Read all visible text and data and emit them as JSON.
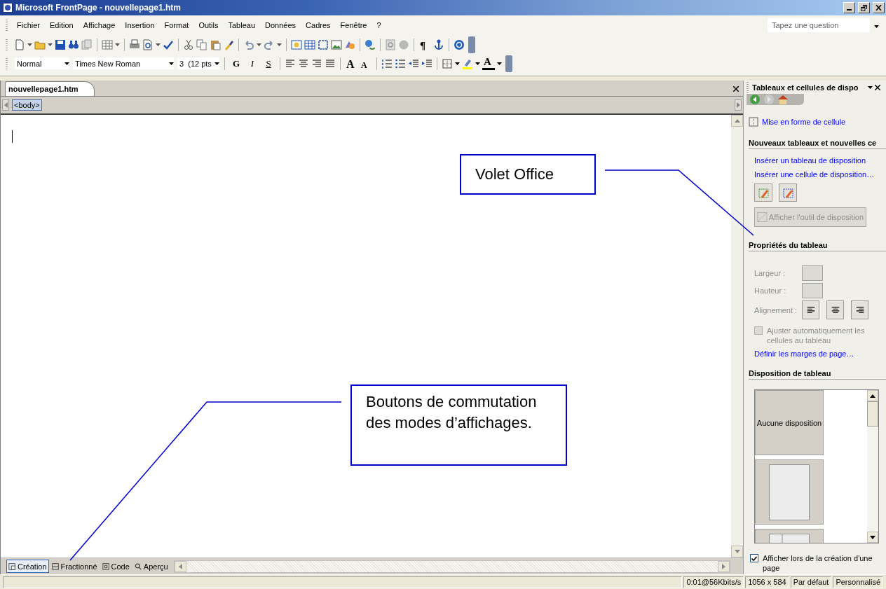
{
  "window": {
    "title": "Microsoft FrontPage - nouvellepage1.htm"
  },
  "menu": [
    {
      "label": "Fichier"
    },
    {
      "label": "Edition"
    },
    {
      "label": "Affichage"
    },
    {
      "label": "Insertion"
    },
    {
      "label": "Format"
    },
    {
      "label": "Outils"
    },
    {
      "label": "Tableau"
    },
    {
      "label": "Données"
    },
    {
      "label": "Cadres"
    },
    {
      "label": "Fenêtre"
    },
    {
      "label": "?"
    }
  ],
  "help_field": {
    "placeholder": "Tapez une question"
  },
  "standard_toolbar": {
    "paragraph_mark": "¶"
  },
  "formatting_toolbar": {
    "style": "Normal",
    "font": "Times New Roman",
    "size": "3  (12 pts",
    "styles": [
      {
        "kind": "bold",
        "label": "G"
      },
      {
        "kind": "italic",
        "label": "I"
      },
      {
        "kind": "strike",
        "label": "S"
      }
    ],
    "grow_font": "A",
    "shrink_font": "A",
    "font_color": "A"
  },
  "document": {
    "tabs": [
      {
        "label": "nouvellepage1.htm",
        "selected": true
      }
    ],
    "quick_tag": "<body>"
  },
  "view_tabs": [
    {
      "kind": "design",
      "label": "Création",
      "selected": true
    },
    {
      "kind": "split",
      "label": "Fractionné",
      "selected": false
    },
    {
      "kind": "code",
      "label": "Code",
      "selected": false
    },
    {
      "kind": "preview",
      "label": "Aperçu",
      "selected": false
    }
  ],
  "task_pane": {
    "title": "Tableaux et cellules de dispo",
    "cell_format_link": "Mise en forme de cellule",
    "new_tables": {
      "heading": "Nouveaux tableaux et nouvelles ce",
      "links": [
        "Insérer un tableau de disposition",
        "Insérer une cellule de disposition…"
      ],
      "tool_button": {
        "label": "Afficher l'outil de disposition",
        "disabled": true
      }
    },
    "table_properties": {
      "heading": "Propriétés du tableau",
      "disabled": true,
      "width_label": "Largeur :",
      "height_label": "Hauteur :",
      "align_label": "Alignement :",
      "autofit": {
        "label": "Ajuster automatiquement les cellules au tableau",
        "checked": false
      },
      "margins_link": "Définir les marges de page…"
    },
    "table_layout": {
      "heading": "Disposition de tableau",
      "layouts": [
        {
          "kind": "none",
          "label": "Aucune disposition",
          "selected": false
        },
        {
          "kind": "centered",
          "selected": false
        },
        {
          "kind": "columns",
          "selected": false
        }
      ]
    },
    "show_on_create": {
      "label": "Afficher lors de la création d'une page",
      "checked": true
    }
  },
  "status_bar": [
    "0:01@56Kbits/s",
    "1056 x 584",
    "Par défaut",
    "Personnalisé"
  ],
  "callouts": [
    {
      "kind": "task_pane",
      "text": "Volet Office"
    },
    {
      "kind": "view_buttons",
      "text": "Boutons de commutation des modes d’affichages."
    }
  ]
}
